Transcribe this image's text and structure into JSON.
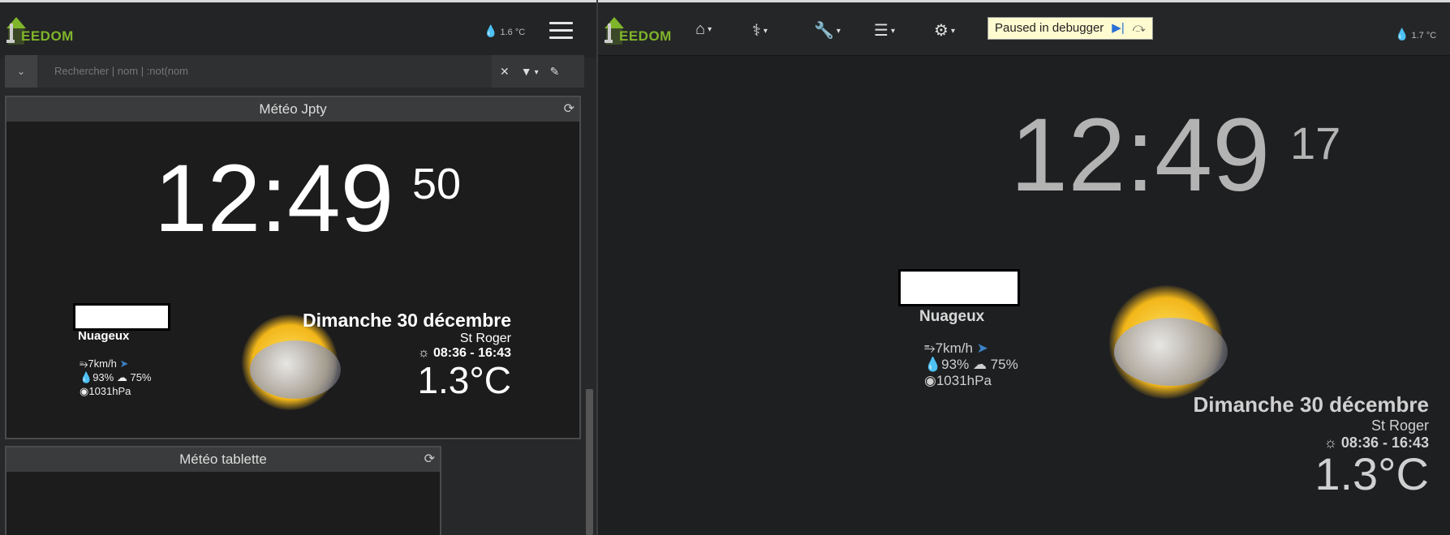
{
  "left": {
    "logo_text": "EEDOM",
    "humidity": "1.6 °C",
    "search": {
      "placeholder": "Rechercher | nom | :not(nom"
    },
    "widget1": {
      "title": "Météo Jpty",
      "time": "12:49",
      "seconds": "50",
      "condition": "Nuageux",
      "wind": "7km/h",
      "humidity": "93%",
      "cloud": "75%",
      "pressure": "1031hPa",
      "date": "Dimanche 30 décembre",
      "saint": "St Roger",
      "sun": "08:36 - 16:43",
      "temp": "1.3°C"
    },
    "widget2": {
      "title": "Météo tablette"
    }
  },
  "right": {
    "logo_text": "EEDOM",
    "humidity": "1.7 °C",
    "debugger": {
      "label": "Paused in debugger"
    },
    "widget": {
      "time": "12:49",
      "seconds": "17",
      "condition": "Nuageux",
      "wind": "7km/h",
      "humidity": "93%",
      "cloud": "75%",
      "pressure": "1031hPa",
      "date": "Dimanche 30 décembre",
      "saint": "St Roger",
      "sun": "08:36 - 16:43",
      "temp": "1.3°C"
    }
  },
  "colors": {
    "brand": "#7fb52a",
    "background": "#1e1f21",
    "drop": "#3b82c4"
  },
  "icons": [
    "home-icon",
    "stethoscope-icon",
    "wrench-icon",
    "tasks-icon",
    "gear-icon",
    "menu-icon",
    "search-clear-icon",
    "filter-icon",
    "pencil-icon",
    "refresh-icon",
    "wind-icon",
    "navigation-arrow-icon",
    "humidity-icon",
    "cloud-icon",
    "pressure-icon",
    "sun-icon",
    "water-drop-icon",
    "resume-icon",
    "step-over-icon"
  ]
}
